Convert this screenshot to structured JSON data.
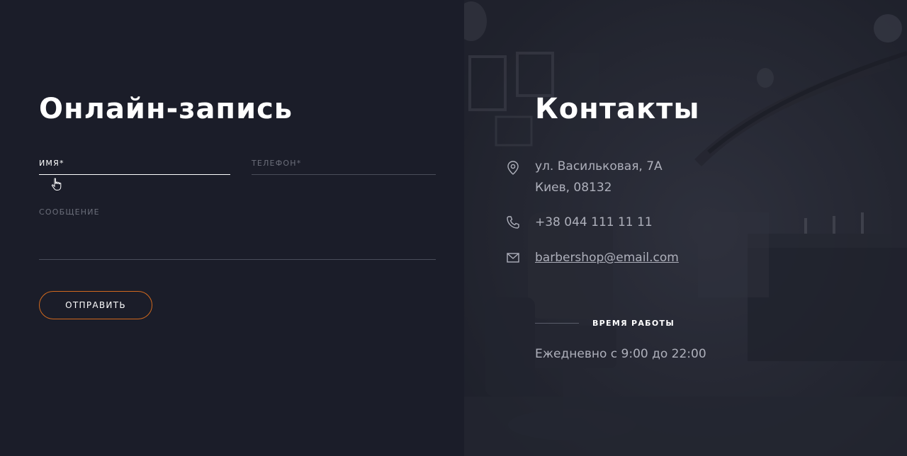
{
  "form": {
    "title": "Онлайн-запись",
    "name_label": "ИМЯ*",
    "phone_label": "ТЕЛЕФОН*",
    "message_label": "СООБЩЕНИЕ",
    "submit_label": "ОТПРАВИТЬ",
    "name_value": "",
    "phone_value": "",
    "message_value": ""
  },
  "contacts": {
    "title": "Контакты",
    "address_line1": "ул. Васильковая, 7А",
    "address_line2": "Киев, 08132",
    "phone": "+38 044 111 11 11",
    "email": "barbershop@email.com",
    "hours_title": "ВРЕМЯ РАБОТЫ",
    "hours_text": "Ежедневно с 9:00 до 22:00",
    "icons": [
      "location-pin-icon",
      "phone-icon",
      "mail-icon"
    ]
  },
  "colors": {
    "accent": "#d2691e",
    "background": "#1b1d29",
    "muted_text": "#aeb0bb",
    "label_muted": "#6b6e7a"
  }
}
